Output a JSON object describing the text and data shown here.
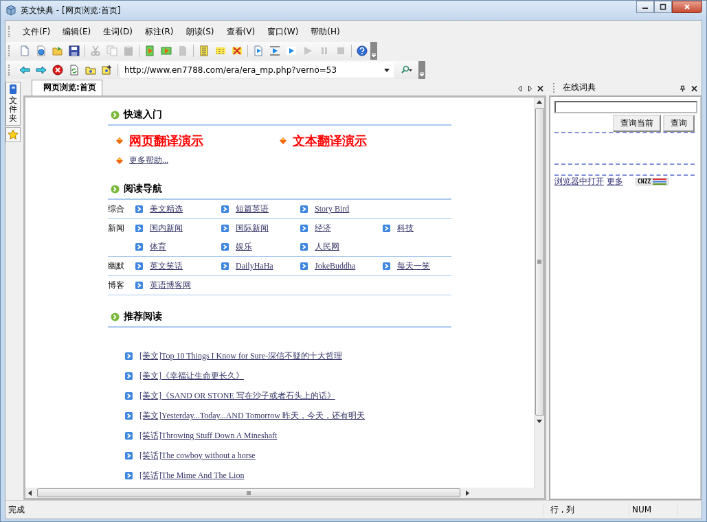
{
  "window": {
    "title": "英文快典 - [网页浏览:首页]"
  },
  "menu": [
    "文件(F)",
    "编辑(E)",
    "生词(D)",
    "标注(R)",
    "朗读(S)",
    "查看(V)",
    "窗口(W)",
    "帮助(H)"
  ],
  "toolbar": [
    {
      "kind": "new",
      "disabled": false
    },
    {
      "kind": "web",
      "disabled": false
    },
    {
      "kind": "open",
      "disabled": false
    },
    {
      "kind": "save",
      "disabled": false
    },
    {
      "kind": "sep"
    },
    {
      "kind": "cut",
      "disabled": true
    },
    {
      "kind": "copy",
      "disabled": true
    },
    {
      "kind": "paste",
      "disabled": true
    },
    {
      "kind": "sep"
    },
    {
      "kind": "play-doc",
      "disabled": false
    },
    {
      "kind": "play-bar",
      "disabled": false
    },
    {
      "kind": "doc",
      "disabled": true
    },
    {
      "kind": "sep"
    },
    {
      "kind": "text-doc",
      "disabled": false
    },
    {
      "kind": "highlight",
      "disabled": false
    },
    {
      "kind": "clear",
      "disabled": false
    },
    {
      "kind": "sep"
    },
    {
      "kind": "play-page",
      "disabled": false
    },
    {
      "kind": "play-line",
      "disabled": false
    },
    {
      "kind": "play-word",
      "disabled": false
    },
    {
      "kind": "play",
      "disabled": true
    },
    {
      "kind": "pause",
      "disabled": true
    },
    {
      "kind": "stop",
      "disabled": true
    },
    {
      "kind": "sep"
    },
    {
      "kind": "help",
      "disabled": false
    }
  ],
  "address_bar": {
    "url": "http://www.en7788.com/era/era_mp.php?verno=53"
  },
  "side_tabs": [
    {
      "kind": "folder",
      "label": "文件夹"
    },
    {
      "kind": "favorites"
    }
  ],
  "doc_tabs": [
    {
      "label": "网页浏览:首页",
      "selected": true
    }
  ],
  "page": {
    "quick_start": {
      "title": "快速入门",
      "demos": [
        "网页翻译演示",
        "文本翻译演示"
      ],
      "more": "更多帮助..."
    },
    "nav": {
      "title": "阅读导航",
      "groups": [
        {
          "label": "综合",
          "lines": [
            [
              "美文精选",
              "短篇英语",
              "Story Bird"
            ]
          ]
        },
        {
          "label": "新闻",
          "lines": [
            [
              "国内新闻",
              "国际新闻",
              "经济",
              "科技"
            ],
            [
              "体育",
              "娱乐",
              "人民网"
            ]
          ]
        },
        {
          "label": "幽默",
          "lines": [
            [
              "英文笑话",
              "DailyHaHa",
              "JokeBuddha",
              "每天一笑"
            ]
          ]
        },
        {
          "label": "博客",
          "lines": [
            [
              "英语博客网"
            ]
          ]
        }
      ]
    },
    "recommended": {
      "title": "推荐阅读",
      "items": [
        "[美文]Top 10 Things I Know for Sure-深信不疑的十大哲理",
        "[美文]《幸福让生命更长久》",
        "[美文]《SAND OR STONE 写在沙子或者石头上的话》",
        "[美文]Yesterday...Today...AND Tomorrow 昨天，今天，还有明天",
        "[笑话]Throwing Stuff Down A Mineshaft",
        "[笑话]The cowboy without a horse",
        "[笑话]The Mime And The Lion"
      ]
    }
  },
  "dictionary_panel": {
    "title": "在线词典",
    "buttons": [
      "查询当前",
      "查询"
    ],
    "links": [
      "浏览器中打开",
      "更多"
    ],
    "badge": "CNZZ"
  },
  "status_bar": {
    "message": "完成",
    "position": "行 , 列",
    "num": "NUM"
  }
}
